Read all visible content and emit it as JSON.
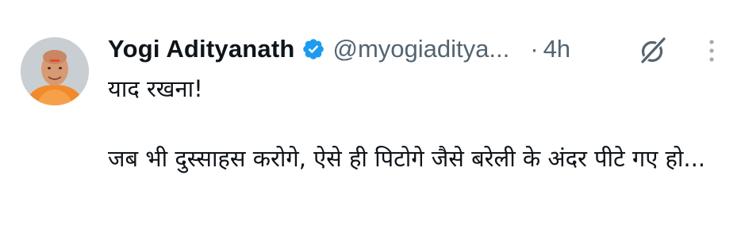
{
  "tweet": {
    "author_name": "Yogi Adityanath",
    "handle": "@myogiaditya...",
    "separator": "·",
    "time": "4h",
    "text_line1": "याद रखना!",
    "text_line2": "जब भी दुस्साहस करोगे, ऐसे ही पिटोगे जैसे बरेली के अंदर पीटे गए हो...",
    "verified_color": "#1d9bf0",
    "icons": {
      "verified": "verified-badge-icon",
      "grok": "grok-icon",
      "more": "more-vertical-icon"
    }
  }
}
